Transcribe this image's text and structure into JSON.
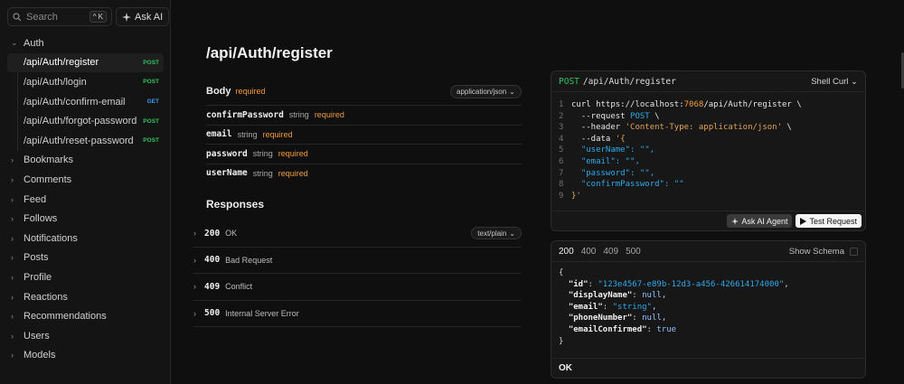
{
  "sidebar": {
    "search_placeholder": "Search",
    "search_shortcut": "^ K",
    "ask_ai_label": "Ask AI",
    "active_group": {
      "label": "Auth",
      "items": [
        {
          "label": "/api/Auth/register",
          "method": "POST"
        },
        {
          "label": "/api/Auth/login",
          "method": "POST"
        },
        {
          "label": "/api/Auth/confirm-email",
          "method": "GET"
        },
        {
          "label": "/api/Auth/forgot-password",
          "method": "POST"
        },
        {
          "label": "/api/Auth/reset-password",
          "method": "POST"
        }
      ]
    },
    "groups": [
      "Bookmarks",
      "Comments",
      "Feed",
      "Follows",
      "Notifications",
      "Posts",
      "Profile",
      "Reactions",
      "Recommendations",
      "Users",
      "Models"
    ]
  },
  "page": {
    "title": "/api/Auth/register"
  },
  "body": {
    "label": "Body",
    "required_label": "required",
    "content_type": "application/json",
    "params": [
      {
        "name": "confirmPassword",
        "type": "string",
        "required": "required"
      },
      {
        "name": "email",
        "type": "string",
        "required": "required"
      },
      {
        "name": "password",
        "type": "string",
        "required": "required"
      },
      {
        "name": "userName",
        "type": "string",
        "required": "required"
      }
    ]
  },
  "responses": {
    "label": "Responses",
    "items": [
      {
        "code": "200",
        "desc": "OK",
        "pill": "text/plain"
      },
      {
        "code": "400",
        "desc": "Bad Request",
        "pill": ""
      },
      {
        "code": "409",
        "desc": "Conflict",
        "pill": ""
      },
      {
        "code": "500",
        "desc": "Internal Server Error",
        "pill": ""
      }
    ]
  },
  "request_card": {
    "method": "POST",
    "path": "/api/Auth/register",
    "client": "Shell Curl",
    "lines": [
      {
        "n": "1",
        "parts": [
          [
            "plain",
            "curl https://localhost:"
          ],
          [
            "port",
            "7068"
          ],
          [
            "plain",
            "/api/Auth/register \\"
          ]
        ]
      },
      {
        "n": "2",
        "parts": [
          [
            "plain",
            "  --request "
          ],
          [
            "key",
            "POST"
          ],
          [
            "plain",
            " \\"
          ]
        ]
      },
      {
        "n": "3",
        "parts": [
          [
            "plain",
            "  --header "
          ],
          [
            "str",
            "'Content-Type: application/json'"
          ],
          [
            "plain",
            " \\"
          ]
        ]
      },
      {
        "n": "4",
        "parts": [
          [
            "plain",
            "  --data "
          ],
          [
            "str",
            "'{"
          ]
        ]
      },
      {
        "n": "5",
        "parts": [
          [
            "key",
            "  \"userName\": \"\","
          ]
        ]
      },
      {
        "n": "6",
        "parts": [
          [
            "key",
            "  \"email\": \"\","
          ]
        ]
      },
      {
        "n": "7",
        "parts": [
          [
            "key",
            "  \"password\": \"\","
          ]
        ]
      },
      {
        "n": "8",
        "parts": [
          [
            "key",
            "  \"confirmPassword\": \"\""
          ]
        ]
      },
      {
        "n": "9",
        "parts": [
          [
            "str",
            "}'"
          ]
        ]
      }
    ],
    "ask_agent_label": "Ask AI Agent",
    "test_request_label": "Test Request"
  },
  "response_card": {
    "tabs": [
      "200",
      "400",
      "409",
      "500"
    ],
    "active_tab": "200",
    "show_schema_label": "Show Schema",
    "json_lines": [
      [
        [
          "punc",
          "{"
        ]
      ],
      [
        [
          "punc",
          "  "
        ],
        [
          "key",
          "\"id\""
        ],
        [
          "punc",
          ": "
        ],
        [
          "str",
          "\"123e4567-e89b-12d3-a456-426614174000\""
        ],
        [
          "punc",
          ","
        ]
      ],
      [
        [
          "punc",
          "  "
        ],
        [
          "key",
          "\"displayName\""
        ],
        [
          "punc",
          ": "
        ],
        [
          "lit",
          "null"
        ],
        [
          "punc",
          ","
        ]
      ],
      [
        [
          "punc",
          "  "
        ],
        [
          "key",
          "\"email\""
        ],
        [
          "punc",
          ": "
        ],
        [
          "str",
          "\"string\""
        ],
        [
          "punc",
          ","
        ]
      ],
      [
        [
          "punc",
          "  "
        ],
        [
          "key",
          "\"phoneNumber\""
        ],
        [
          "punc",
          ": "
        ],
        [
          "lit",
          "null"
        ],
        [
          "punc",
          ","
        ]
      ],
      [
        [
          "punc",
          "  "
        ],
        [
          "key",
          "\"emailConfirmed\""
        ],
        [
          "punc",
          ": "
        ],
        [
          "lit",
          "true"
        ]
      ],
      [
        [
          "punc",
          "}"
        ]
      ]
    ],
    "status_text": "OK"
  },
  "colors": {
    "post": "#31c35a",
    "get": "#3a9cf0",
    "required": "#f29c3a",
    "accent_blue": "#2ea9e8"
  }
}
